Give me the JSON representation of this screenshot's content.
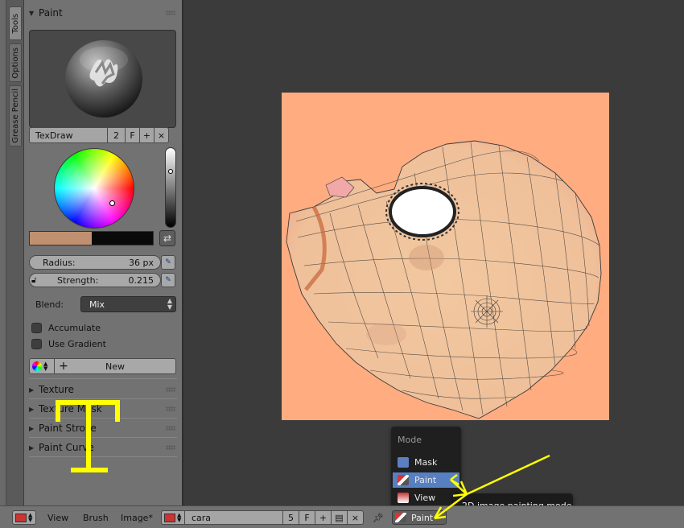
{
  "tabs": [
    {
      "label": "Tools",
      "active": true
    },
    {
      "label": "Options",
      "active": false
    },
    {
      "label": "Grease Pencil",
      "active": false
    }
  ],
  "paint_panel": {
    "title": "Paint",
    "brush_name": "TexDraw",
    "brush_users": "2",
    "fake_user": "F",
    "add_icon": "+",
    "remove_icon": "×",
    "radius_label": "Radius:",
    "radius_value": "36 px",
    "strength_label": "Strength:",
    "strength_value": "0.215",
    "blend_label": "Blend:",
    "blend_value": "Mix",
    "accumulate_label": "Accumulate",
    "gradient_label": "Use Gradient",
    "palette_new_label": "New",
    "primary_color": "#c09070",
    "secondary_color": "#0a0a0a"
  },
  "collapsed_panels": [
    {
      "label": "Texture"
    },
    {
      "label": "Texture Mask"
    },
    {
      "label": "Paint Stroke"
    },
    {
      "label": "Paint Curve"
    }
  ],
  "mode_menu": {
    "title": "Mode",
    "items": [
      {
        "label": "Mask",
        "selected": false
      },
      {
        "label": "Paint",
        "selected": true
      },
      {
        "label": "View",
        "selected": false
      }
    ]
  },
  "tooltip": "2D image painting mode",
  "footer": {
    "menus": [
      "View",
      "Brush",
      "Image*"
    ],
    "image_name": "cara",
    "image_users": "5",
    "fake_user": "F",
    "mode": "Paint"
  },
  "colors": {
    "canvas_bg": "#ffac80",
    "annotation": "#ffff00",
    "highlight": "#5680c2"
  }
}
